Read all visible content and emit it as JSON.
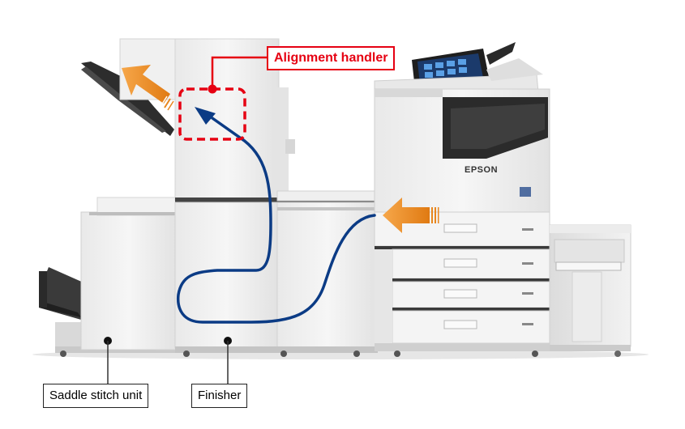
{
  "labels": {
    "alignment_handler": "Alignment handler",
    "saddle_stitch_unit": "Saddle stitch unit",
    "finisher": "Finisher"
  },
  "printer": {
    "brand": "EPSON"
  },
  "colors": {
    "callout_red": "#e60012",
    "paper_path_blue": "#0b3b85",
    "arrow_orange": "#e8861e",
    "machine_body": "#eeeeee",
    "machine_dark": "#2b2b2b"
  },
  "icons": {
    "feed_arrow": "orange-arrow-left-icon",
    "exit_arrow": "orange-arrow-up-left-icon",
    "path_arrow": "blue-arrow-icon"
  }
}
